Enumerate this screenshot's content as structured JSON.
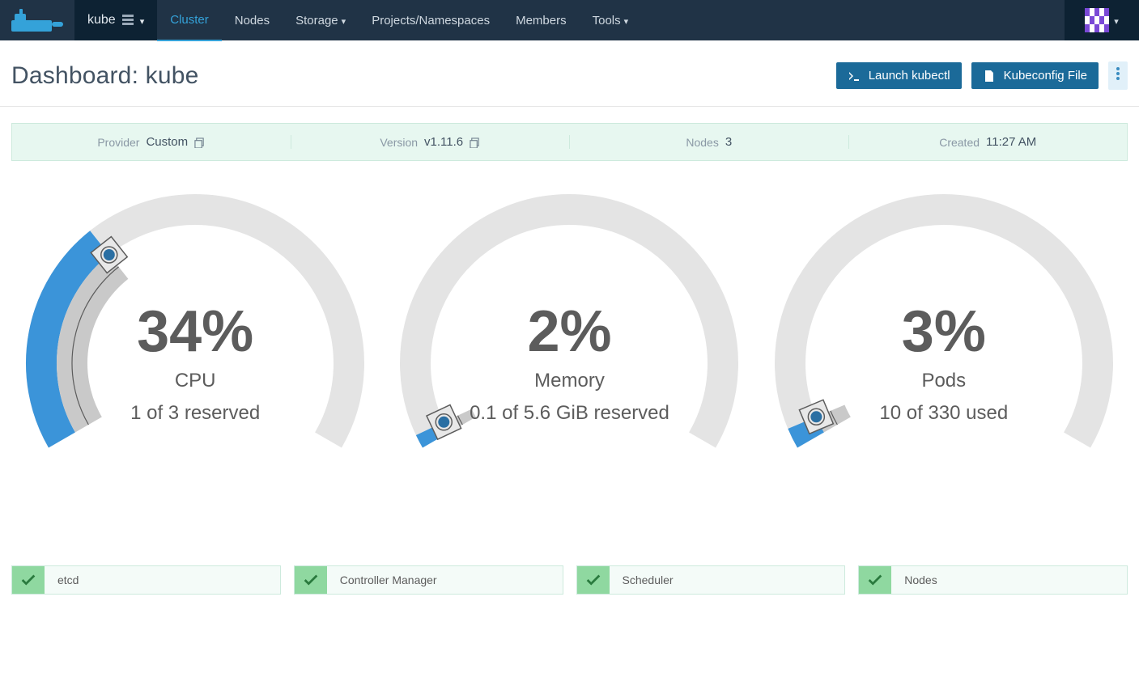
{
  "nav": {
    "cluster_name": "kube",
    "items": [
      "Cluster",
      "Nodes",
      "Storage",
      "Projects/Namespaces",
      "Members",
      "Tools"
    ],
    "active_index": 0,
    "has_dropdown": [
      false,
      false,
      true,
      false,
      false,
      true
    ]
  },
  "header": {
    "title": "Dashboard: kube",
    "launch_label": "Launch kubectl",
    "kubeconfig_label": "Kubeconfig File"
  },
  "infobar": {
    "provider_label": "Provider",
    "provider_value": "Custom",
    "version_label": "Version",
    "version_value": "v1.11.6",
    "nodes_label": "Nodes",
    "nodes_value": "3",
    "created_label": "Created",
    "created_value": "11:27 AM"
  },
  "gauges": [
    {
      "pct": "34%",
      "title": "CPU",
      "sub": "1 of 3 reserved",
      "fraction": 0.34
    },
    {
      "pct": "2%",
      "title": "Memory",
      "sub": "0.1 of 5.6 GiB reserved",
      "fraction": 0.02
    },
    {
      "pct": "3%",
      "title": "Pods",
      "sub": "10 of 330 used",
      "fraction": 0.03
    }
  ],
  "components": [
    "etcd",
    "Controller Manager",
    "Scheduler",
    "Nodes"
  ],
  "colors": {
    "accent": "#34a2d9",
    "gauge_fill": "#3b94d9",
    "gauge_bg": "#e4e4e4",
    "ok": "#8fd8a0"
  },
  "chart_data": [
    {
      "type": "gauge",
      "title": "CPU",
      "value": 34,
      "unit": "%",
      "sublabel": "1 of 3 reserved",
      "range": [
        0,
        100
      ]
    },
    {
      "type": "gauge",
      "title": "Memory",
      "value": 2,
      "unit": "%",
      "sublabel": "0.1 of 5.6 GiB reserved",
      "range": [
        0,
        100
      ]
    },
    {
      "type": "gauge",
      "title": "Pods",
      "value": 3,
      "unit": "%",
      "sublabel": "10 of 330 used",
      "range": [
        0,
        100
      ]
    }
  ]
}
